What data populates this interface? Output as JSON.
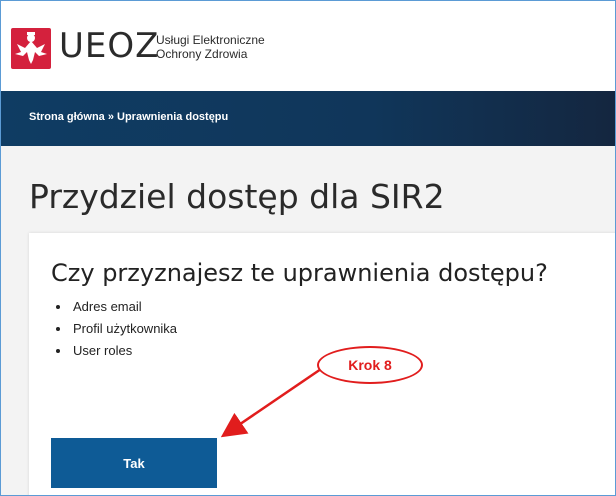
{
  "header": {
    "logo_text": "UEOZ",
    "subtitle_line1": "Usługi Elektroniczne",
    "subtitle_line2": "Ochrony Zdrowia"
  },
  "breadcrumb": {
    "text": "Strona główna » Uprawnienia dostępu"
  },
  "page": {
    "title": "Przydziel dostęp dla SIR2"
  },
  "consent": {
    "question": "Czy przyznajesz te uprawnienia dostępu?",
    "items": [
      "Adres email",
      "Profil użytkownika",
      "User roles"
    ],
    "accept_label": "Tak"
  },
  "annotation": {
    "label": "Krok 8",
    "color": "#e11d1d"
  },
  "colors": {
    "navbar": "#0f3c63",
    "button": "#0e5b96",
    "emblem": "#d4213d"
  }
}
